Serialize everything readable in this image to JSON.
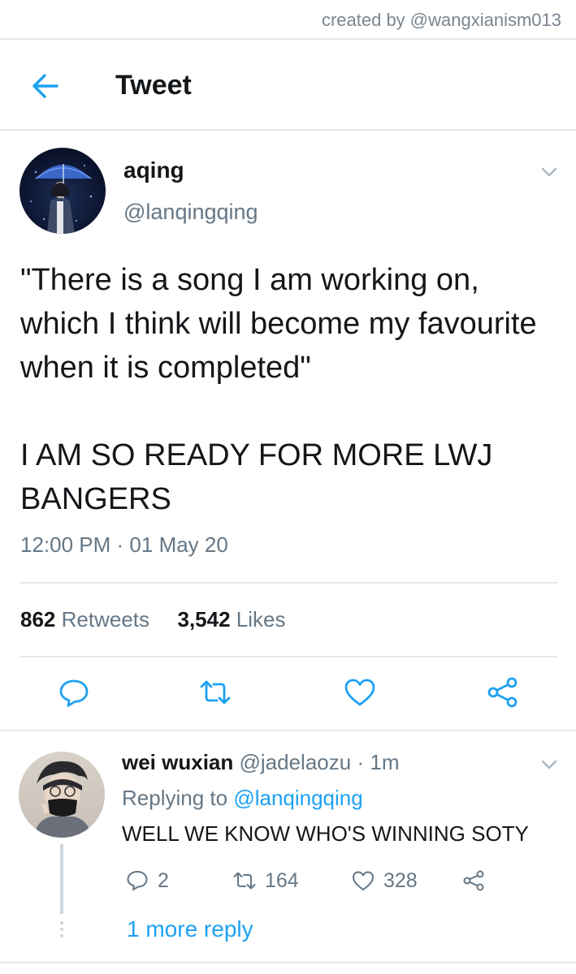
{
  "credit": "created by @wangxianism013",
  "header": {
    "title": "Tweet"
  },
  "tweet": {
    "display_name": "aqing",
    "handle": "@lanqingqing",
    "text_lines": [
      "\"There is a song I am working on, which I think will become my favourite when it is completed\"",
      "I AM SO READY FOR MORE LWJ BANGERS"
    ],
    "time": "12:00 PM",
    "date": "01 May 20",
    "retweets_count": "862",
    "retweets_label": "Retweets",
    "likes_count": "3,542",
    "likes_label": "Likes"
  },
  "reply": {
    "display_name": "wei wuxian",
    "handle": "@jadelaozu",
    "time": "1m",
    "replying_prefix": "Replying to",
    "replying_to": "@lanqingqing",
    "text": "WELL WE KNOW WHO'S WINNING SOTY",
    "reply_count": "2",
    "retweet_count": "164",
    "like_count": "328"
  },
  "more_replies": "1 more reply",
  "colors": {
    "accent": "#1da1f2",
    "secondary_text": "#657786",
    "divider": "#e1e8ed"
  }
}
